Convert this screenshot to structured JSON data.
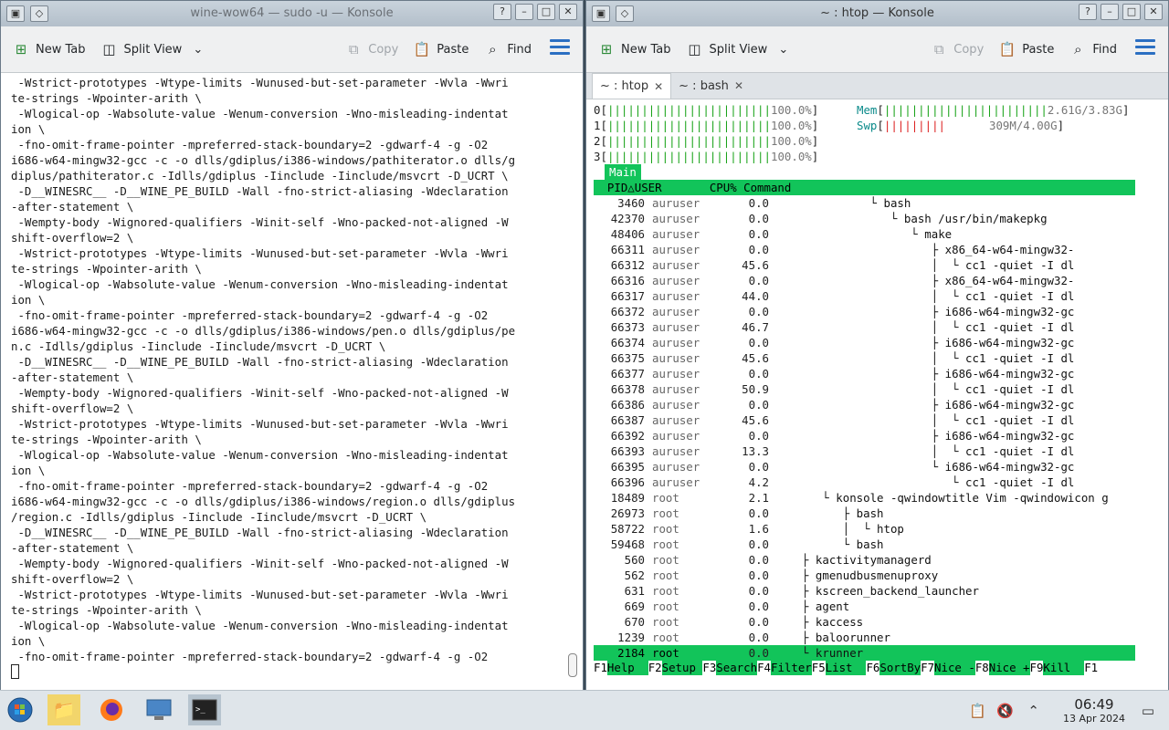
{
  "left_window": {
    "title": "wine-wow64 — sudo -u — Konsole",
    "toolbar": {
      "new_tab": "New Tab",
      "split_view": "Split View",
      "copy": "Copy",
      "paste": "Paste",
      "find": "Find"
    },
    "lines": [
      " -Wstrict-prototypes -Wtype-limits -Wunused-but-set-parameter -Wvla -Wwri",
      "te-strings -Wpointer-arith \\",
      " -Wlogical-op -Wabsolute-value -Wenum-conversion -Wno-misleading-indentat",
      "ion \\",
      " -fno-omit-frame-pointer -mpreferred-stack-boundary=2 -gdwarf-4 -g -O2",
      "i686-w64-mingw32-gcc -c -o dlls/gdiplus/i386-windows/pathiterator.o dlls/g",
      "diplus/pathiterator.c -Idlls/gdiplus -Iinclude -Iinclude/msvcrt -D_UCRT \\",
      " -D__WINESRC__ -D__WINE_PE_BUILD -Wall -fno-strict-aliasing -Wdeclaration",
      "-after-statement \\",
      " -Wempty-body -Wignored-qualifiers -Winit-self -Wno-packed-not-aligned -W",
      "shift-overflow=2 \\",
      " -Wstrict-prototypes -Wtype-limits -Wunused-but-set-parameter -Wvla -Wwri",
      "te-strings -Wpointer-arith \\",
      " -Wlogical-op -Wabsolute-value -Wenum-conversion -Wno-misleading-indentat",
      "ion \\",
      " -fno-omit-frame-pointer -mpreferred-stack-boundary=2 -gdwarf-4 -g -O2",
      "i686-w64-mingw32-gcc -c -o dlls/gdiplus/i386-windows/pen.o dlls/gdiplus/pe",
      "n.c -Idlls/gdiplus -Iinclude -Iinclude/msvcrt -D_UCRT \\",
      " -D__WINESRC__ -D__WINE_PE_BUILD -Wall -fno-strict-aliasing -Wdeclaration",
      "-after-statement \\",
      " -Wempty-body -Wignored-qualifiers -Winit-self -Wno-packed-not-aligned -W",
      "shift-overflow=2 \\",
      " -Wstrict-prototypes -Wtype-limits -Wunused-but-set-parameter -Wvla -Wwri",
      "te-strings -Wpointer-arith \\",
      " -Wlogical-op -Wabsolute-value -Wenum-conversion -Wno-misleading-indentat",
      "ion \\",
      " -fno-omit-frame-pointer -mpreferred-stack-boundary=2 -gdwarf-4 -g -O2",
      "i686-w64-mingw32-gcc -c -o dlls/gdiplus/i386-windows/region.o dlls/gdiplus",
      "/region.c -Idlls/gdiplus -Iinclude -Iinclude/msvcrt -D_UCRT \\",
      " -D__WINESRC__ -D__WINE_PE_BUILD -Wall -fno-strict-aliasing -Wdeclaration",
      "-after-statement \\",
      " -Wempty-body -Wignored-qualifiers -Winit-self -Wno-packed-not-aligned -W",
      "shift-overflow=2 \\",
      " -Wstrict-prototypes -Wtype-limits -Wunused-but-set-parameter -Wvla -Wwri",
      "te-strings -Wpointer-arith \\",
      " -Wlogical-op -Wabsolute-value -Wenum-conversion -Wno-misleading-indentat",
      "ion \\",
      " -fno-omit-frame-pointer -mpreferred-stack-boundary=2 -gdwarf-4 -g -O2"
    ]
  },
  "right_window": {
    "title": "~ : htop — Konsole",
    "toolbar": {
      "new_tab": "New Tab",
      "split_view": "Split View",
      "copy": "Copy",
      "paste": "Paste",
      "find": "Find"
    },
    "tabs": [
      {
        "label": "~ : htop"
      },
      {
        "label": "~ : bash"
      }
    ],
    "htop": {
      "cpus": [
        {
          "id": "0",
          "bar": "||||||||||||||||||||||||",
          "pct": "100.0%"
        },
        {
          "id": "1",
          "bar": "||||||||||||||||||||||||",
          "pct": "100.0%"
        },
        {
          "id": "2",
          "bar": "||||||||||||||||||||||||",
          "pct": "100.0%"
        },
        {
          "id": "3",
          "bar": "||||||||||||||||||||||||",
          "pct": "100.0%"
        }
      ],
      "mem": {
        "label": "Mem",
        "bar": "||||||||||||||||||||||||",
        "value": "2.61G/3.83G"
      },
      "swp": {
        "label": "Swp",
        "bar": "|||||||||",
        "value": "309M/4.00G"
      },
      "main_tab": "Main",
      "header": "  PID△USER       CPU% Command",
      "rows": [
        {
          "pid": "3460",
          "user": "auruser",
          "cpu": "0.0",
          "cmd": "          └ bash"
        },
        {
          "pid": "42370",
          "user": "auruser",
          "cpu": "0.0",
          "cmd": "             └ bash /usr/bin/makepkg"
        },
        {
          "pid": "48406",
          "user": "auruser",
          "cpu": "0.0",
          "cmd": "                └ make"
        },
        {
          "pid": "66311",
          "user": "auruser",
          "cpu": "0.0",
          "cmd": "                   ├ x86_64-w64-mingw32-"
        },
        {
          "pid": "66312",
          "user": "auruser",
          "cpu": "45.6",
          "cmd": "                   │  └ cc1 -quiet -I dl"
        },
        {
          "pid": "66316",
          "user": "auruser",
          "cpu": "0.0",
          "cmd": "                   ├ x86_64-w64-mingw32-"
        },
        {
          "pid": "66317",
          "user": "auruser",
          "cpu": "44.0",
          "cmd": "                   │  └ cc1 -quiet -I dl"
        },
        {
          "pid": "66372",
          "user": "auruser",
          "cpu": "0.0",
          "cmd": "                   ├ i686-w64-mingw32-gc"
        },
        {
          "pid": "66373",
          "user": "auruser",
          "cpu": "46.7",
          "cmd": "                   │  └ cc1 -quiet -I dl"
        },
        {
          "pid": "66374",
          "user": "auruser",
          "cpu": "0.0",
          "cmd": "                   ├ i686-w64-mingw32-gc"
        },
        {
          "pid": "66375",
          "user": "auruser",
          "cpu": "45.6",
          "cmd": "                   │  └ cc1 -quiet -I dl"
        },
        {
          "pid": "66377",
          "user": "auruser",
          "cpu": "0.0",
          "cmd": "                   ├ i686-w64-mingw32-gc"
        },
        {
          "pid": "66378",
          "user": "auruser",
          "cpu": "50.9",
          "cmd": "                   │  └ cc1 -quiet -I dl"
        },
        {
          "pid": "66386",
          "user": "auruser",
          "cpu": "0.0",
          "cmd": "                   ├ i686-w64-mingw32-gc"
        },
        {
          "pid": "66387",
          "user": "auruser",
          "cpu": "45.6",
          "cmd": "                   │  └ cc1 -quiet -I dl"
        },
        {
          "pid": "66392",
          "user": "auruser",
          "cpu": "0.0",
          "cmd": "                   ├ i686-w64-mingw32-gc"
        },
        {
          "pid": "66393",
          "user": "auruser",
          "cpu": "13.3",
          "cmd": "                   │  └ cc1 -quiet -I dl"
        },
        {
          "pid": "66395",
          "user": "auruser",
          "cpu": "0.0",
          "cmd": "                   └ i686-w64-mingw32-gc"
        },
        {
          "pid": "66396",
          "user": "auruser",
          "cpu": "4.2",
          "cmd": "                      └ cc1 -quiet -I dl"
        },
        {
          "pid": "18489",
          "user": "root",
          "cpu": "2.1",
          "cmd": "   └ konsole -qwindowtitle Vim -qwindowicon g"
        },
        {
          "pid": "26973",
          "user": "root",
          "cpu": "0.0",
          "cmd": "      ├ bash"
        },
        {
          "pid": "58722",
          "user": "root",
          "cpu": "1.6",
          "cmd": "      │  └ htop"
        },
        {
          "pid": "59468",
          "user": "root",
          "cpu": "0.0",
          "cmd": "      └ bash"
        },
        {
          "pid": "560",
          "user": "root",
          "cpu": "0.0",
          "cmd": "├ kactivitymanagerd"
        },
        {
          "pid": "562",
          "user": "root",
          "cpu": "0.0",
          "cmd": "├ gmenudbusmenuproxy"
        },
        {
          "pid": "631",
          "user": "root",
          "cpu": "0.0",
          "cmd": "├ kscreen_backend_launcher"
        },
        {
          "pid": "669",
          "user": "root",
          "cpu": "0.0",
          "cmd": "├ agent"
        },
        {
          "pid": "670",
          "user": "root",
          "cpu": "0.0",
          "cmd": "├ kaccess"
        },
        {
          "pid": "1239",
          "user": "root",
          "cpu": "0.0",
          "cmd": "├ baloorunner"
        },
        {
          "pid": "2184",
          "user": "root",
          "cpu": "0.0",
          "cmd": "└ krunner"
        }
      ],
      "fkeys": [
        {
          "key": "F1",
          "label": "Help  "
        },
        {
          "key": "F2",
          "label": "Setup "
        },
        {
          "key": "F3",
          "label": "Search"
        },
        {
          "key": "F4",
          "label": "Filter"
        },
        {
          "key": "F5",
          "label": "List  "
        },
        {
          "key": "F6",
          "label": "SortBy"
        },
        {
          "key": "F7",
          "label": "Nice -"
        },
        {
          "key": "F8",
          "label": "Nice +"
        },
        {
          "key": "F9",
          "label": "Kill  "
        },
        {
          "key": "F1",
          "label": ""
        }
      ]
    }
  },
  "taskbar": {
    "time": "06:49",
    "date": "13 Apr 2024"
  },
  "icons": {
    "start": "start-orb-icon",
    "files": "folder-icon",
    "browser": "firefox-icon",
    "monitor": "system-monitor-icon",
    "terminal": "terminal-icon"
  },
  "colors": {
    "htop_green": "#12c45a",
    "accent": "#2b6fc2"
  }
}
